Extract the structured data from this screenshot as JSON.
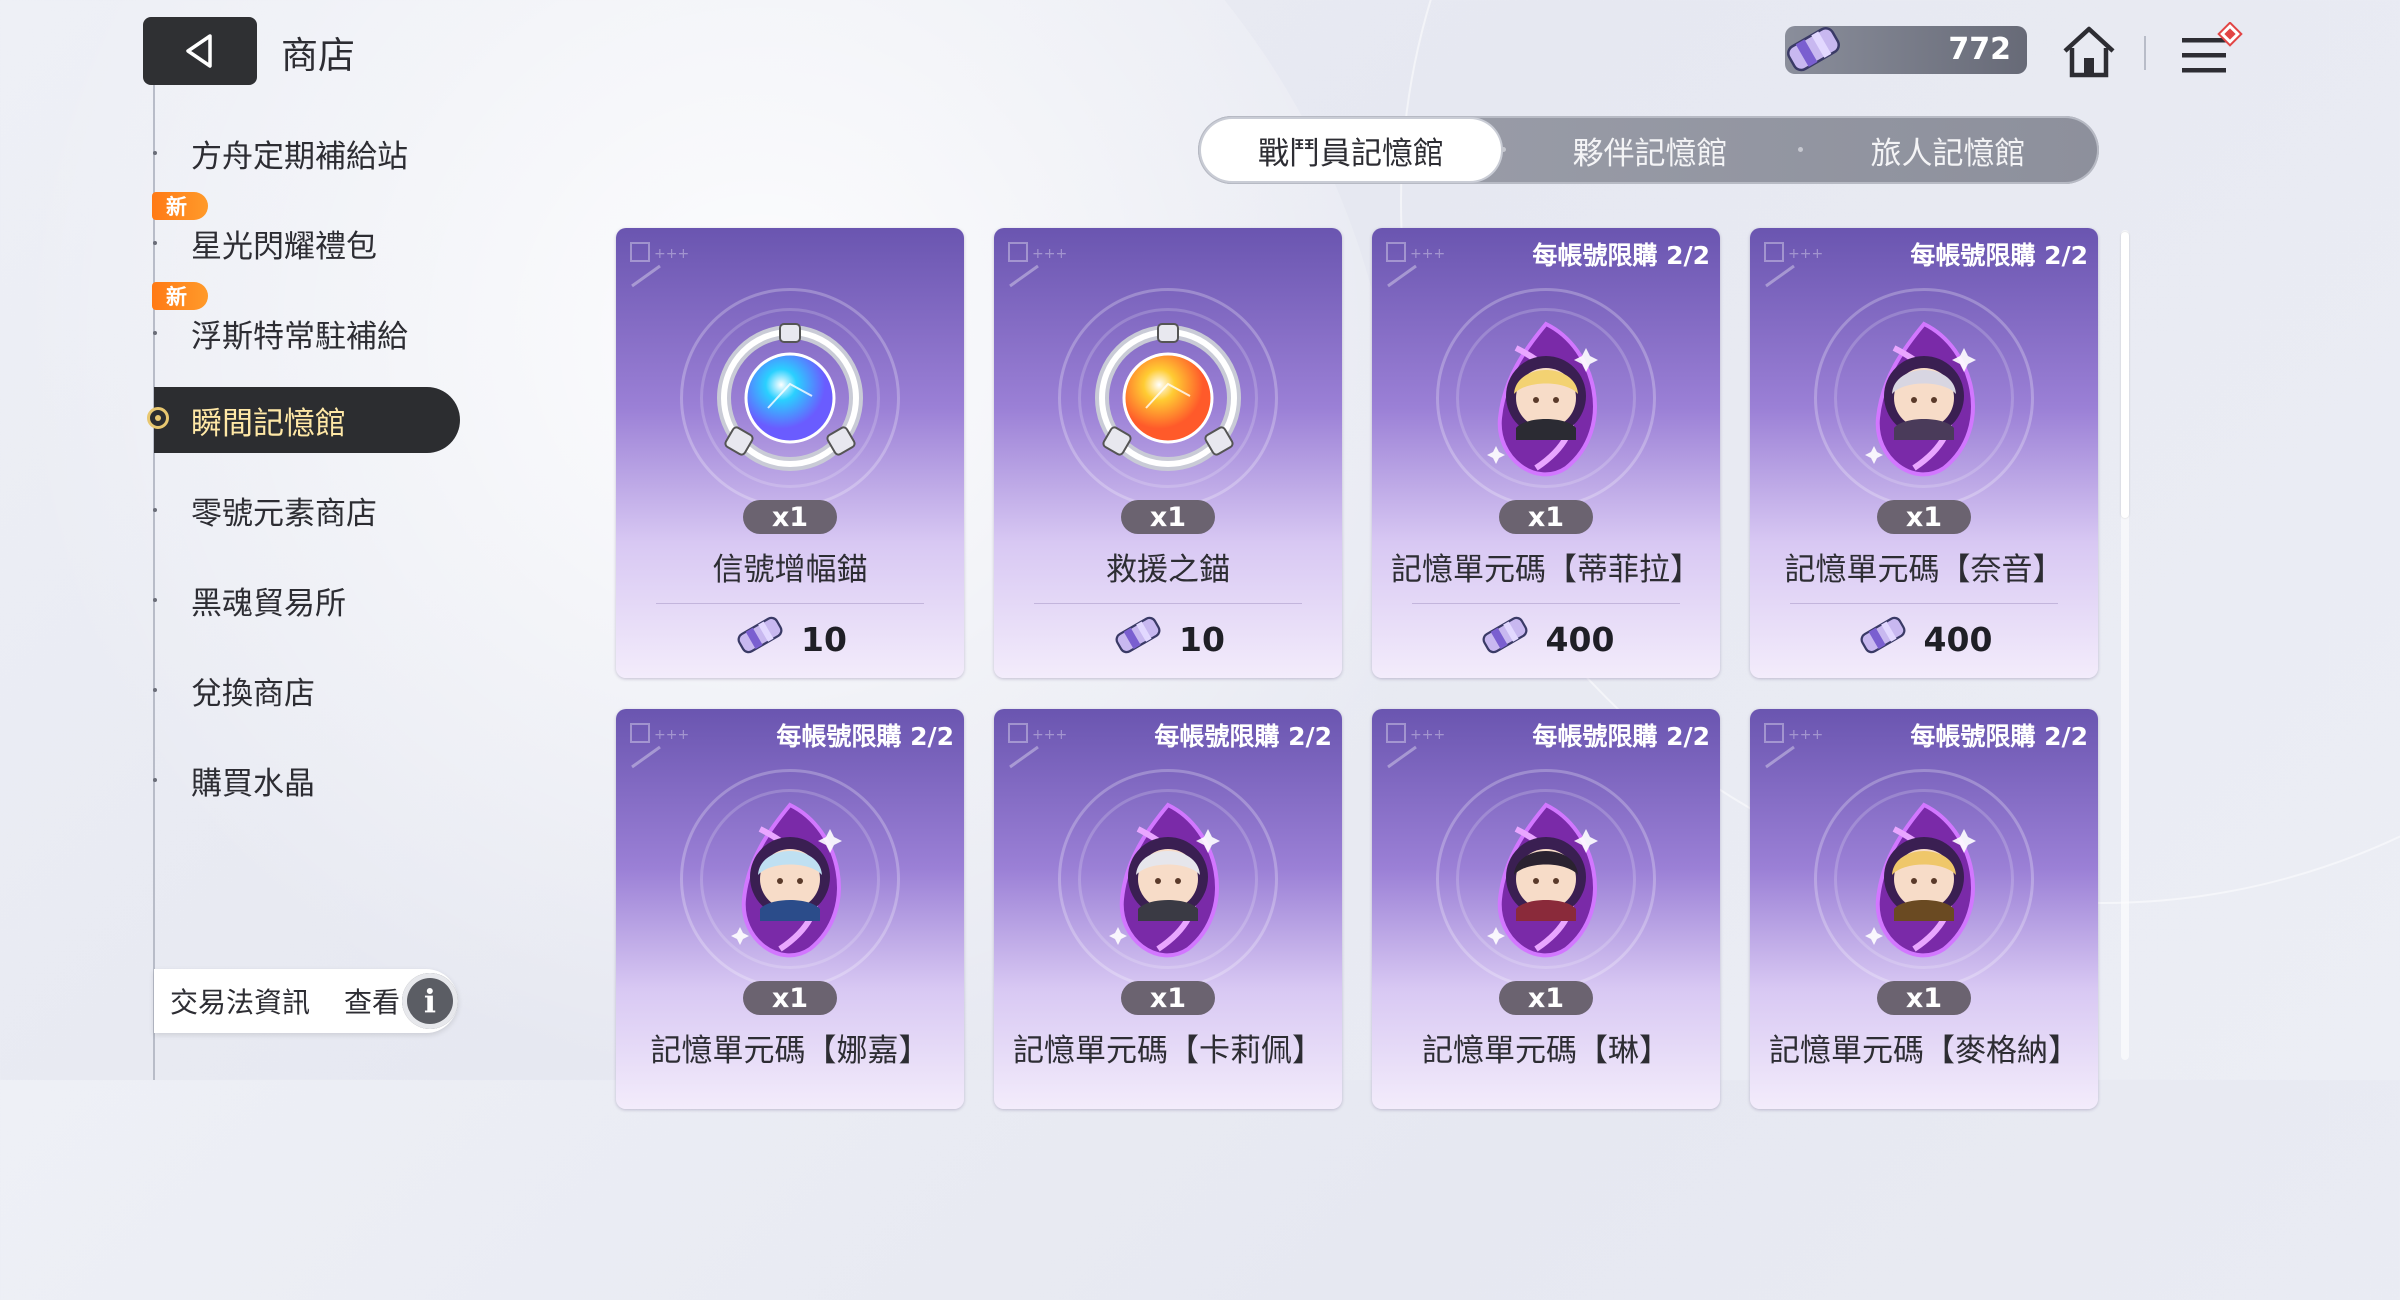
{
  "header": {
    "title": "商店",
    "currency_value": "772"
  },
  "sidebar": {
    "items": [
      {
        "label": "方舟定期補給站",
        "badge": "",
        "active": false
      },
      {
        "label": "星光閃耀禮包",
        "badge": "新",
        "active": false
      },
      {
        "label": "浮斯特常駐補給",
        "badge": "新",
        "active": false
      },
      {
        "label": "瞬間記憶館",
        "badge": "",
        "active": true
      },
      {
        "label": "零號元素商店",
        "badge": "",
        "active": false
      },
      {
        "label": "黑魂貿易所",
        "badge": "",
        "active": false
      },
      {
        "label": "兌換商店",
        "badge": "",
        "active": false
      },
      {
        "label": "購買水晶",
        "badge": "",
        "active": false
      }
    ],
    "trade_info": {
      "label": "交易法資訊",
      "view": "查看",
      "icon_text": "i"
    }
  },
  "tabs": [
    {
      "label": "戰鬥員記憶館",
      "active": true
    },
    {
      "label": "夥伴記憶館",
      "active": false
    },
    {
      "label": "旅人記憶館",
      "active": false
    }
  ],
  "cards": [
    {
      "name": "信號增幅錨",
      "qty": "x1",
      "price": "10",
      "limit": "",
      "art": "blue-anchor"
    },
    {
      "name": "救援之錨",
      "qty": "x1",
      "price": "10",
      "limit": "",
      "art": "orange-anchor"
    },
    {
      "name": "記憶單元碼【蒂菲拉】",
      "qty": "x1",
      "price": "400",
      "limit": "每帳號限購 2/2",
      "art": "portrait-blonde"
    },
    {
      "name": "記憶單元碼【奈音】",
      "qty": "x1",
      "price": "400",
      "limit": "每帳號限購 2/2",
      "art": "portrait-silver"
    },
    {
      "name": "記憶單元碼【娜嘉】",
      "qty": "x1",
      "price": "",
      "limit": "每帳號限購 2/2",
      "art": "portrait-blue"
    },
    {
      "name": "記憶單元碼【卡莉佩】",
      "qty": "x1",
      "price": "",
      "limit": "每帳號限購 2/2",
      "art": "portrait-white"
    },
    {
      "name": "記憶單元碼【琳】",
      "qty": "x1",
      "price": "",
      "limit": "每帳號限購 2/2",
      "art": "portrait-black"
    },
    {
      "name": "記憶單元碼【麥格納】",
      "qty": "x1",
      "price": "",
      "limit": "每帳號限購 2/2",
      "art": "portrait-gold"
    }
  ],
  "colors": {
    "accent_gold": "#e8c770",
    "badge_orange": "#ff7a16",
    "active_item_bg": "#2c2d30"
  }
}
